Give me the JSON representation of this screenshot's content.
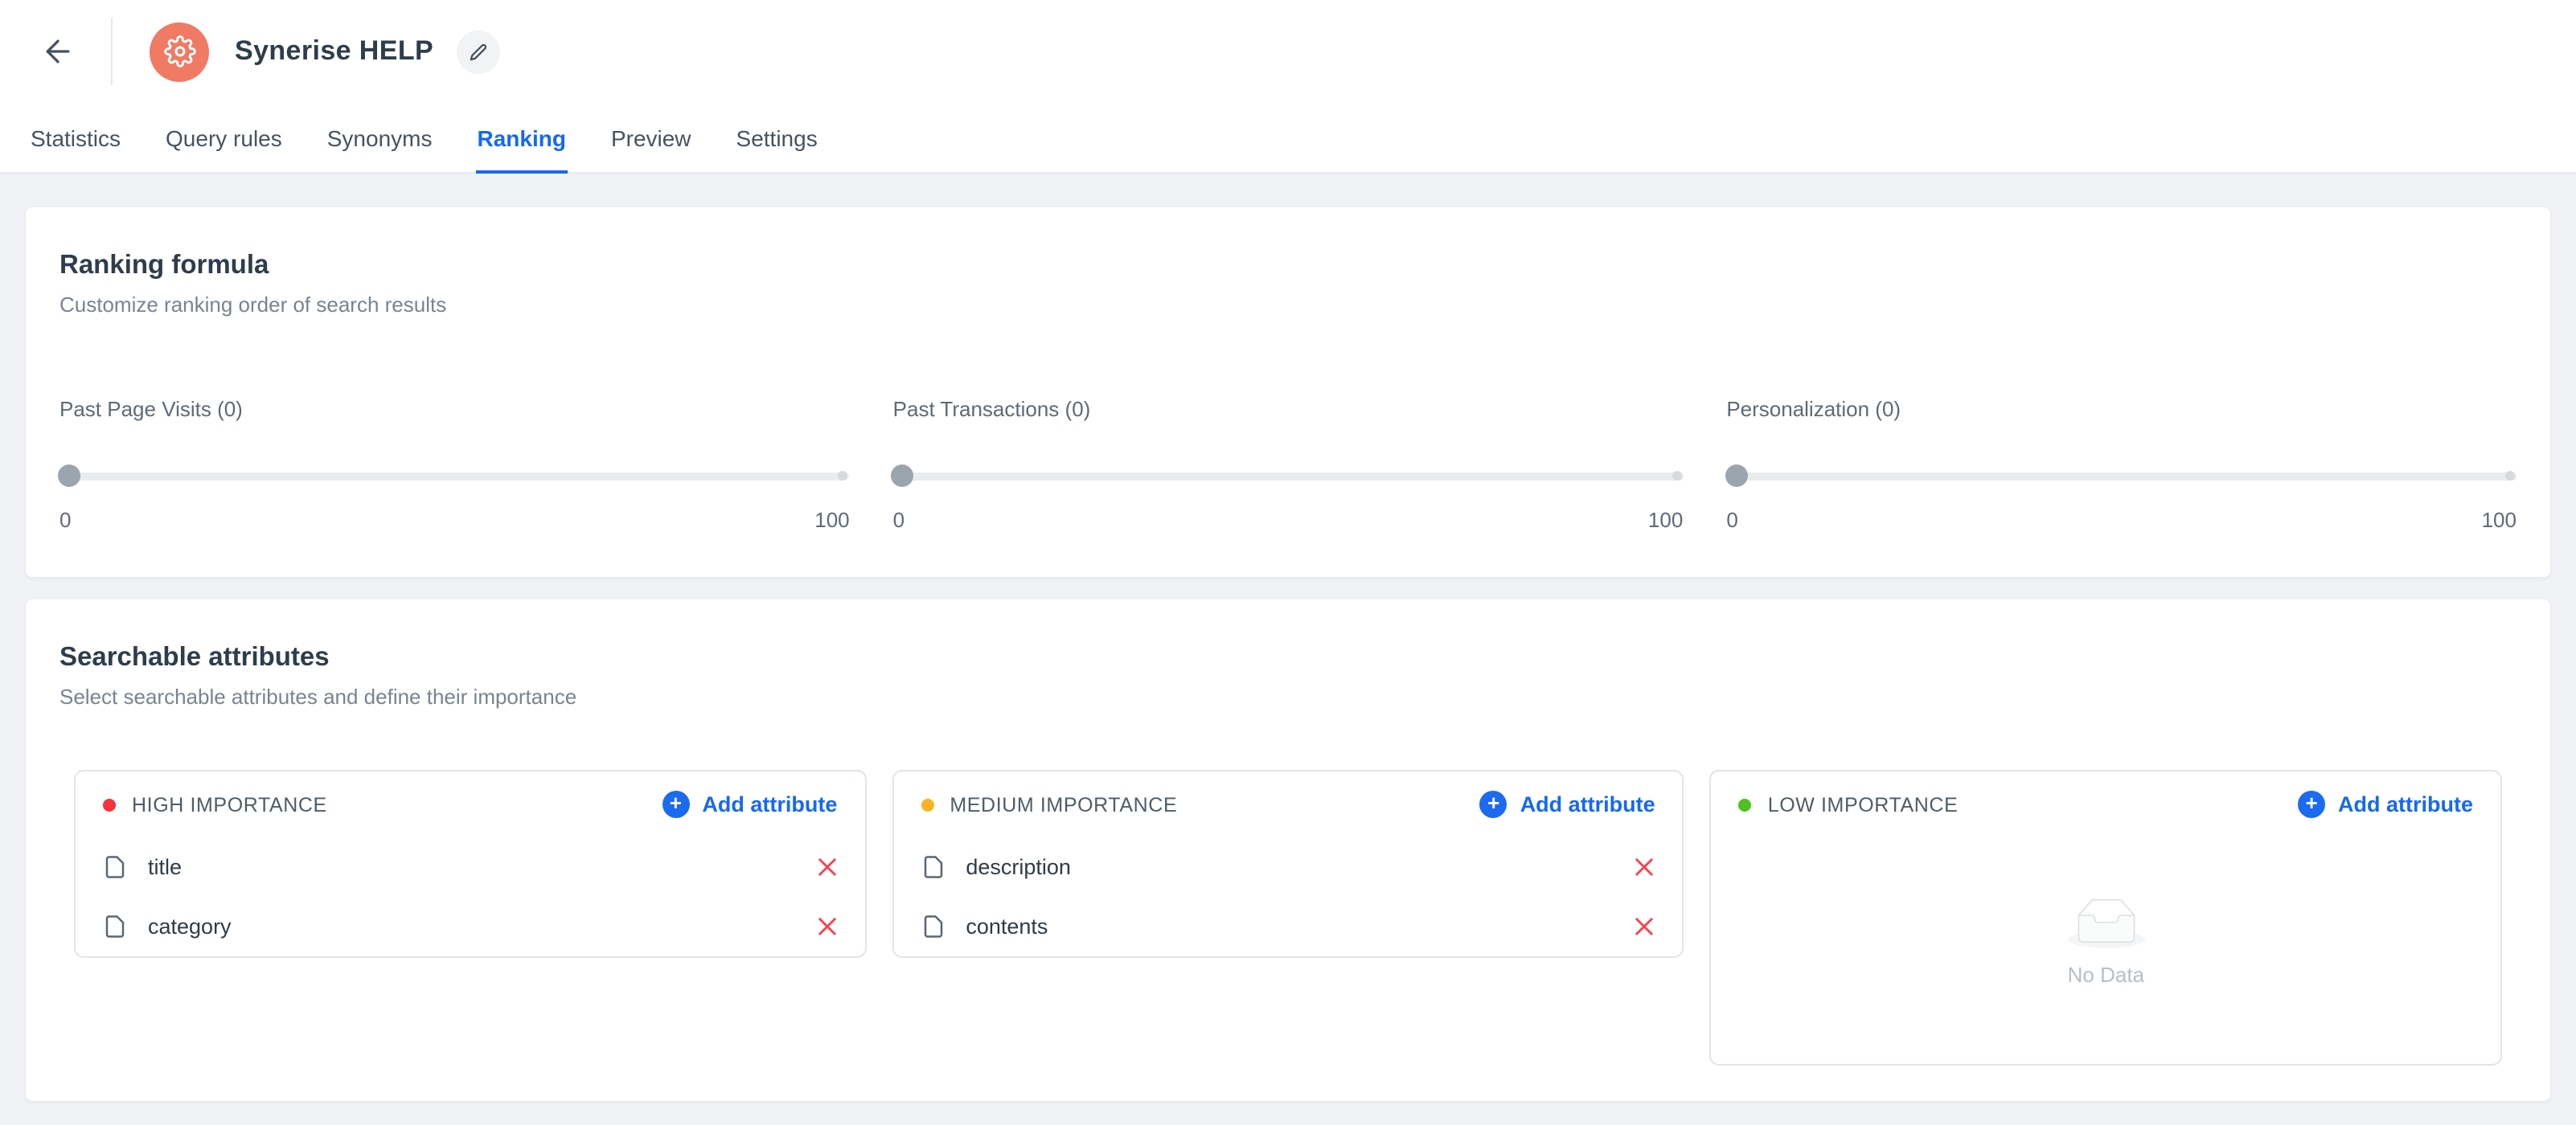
{
  "header": {
    "app_title": "Synerise HELP"
  },
  "tabs": {
    "items": [
      {
        "label": "Statistics",
        "active": false
      },
      {
        "label": "Query rules",
        "active": false
      },
      {
        "label": "Synonyms",
        "active": false
      },
      {
        "label": "Ranking",
        "active": true
      },
      {
        "label": "Preview",
        "active": false
      },
      {
        "label": "Settings",
        "active": false
      }
    ]
  },
  "ranking": {
    "title": "Ranking formula",
    "subtitle": "Customize ranking order of search results",
    "sliders": [
      {
        "label": "Past Page Visits (0)",
        "value": 0,
        "min_label": "0",
        "max_label": "100"
      },
      {
        "label": "Past Transactions (0)",
        "value": 0,
        "min_label": "0",
        "max_label": "100"
      },
      {
        "label": "Personalization (0)",
        "value": 0,
        "min_label": "0",
        "max_label": "100"
      }
    ]
  },
  "attributes": {
    "title": "Searchable attributes",
    "subtitle": "Select searchable attributes and define their importance",
    "groups": [
      {
        "name": "HIGH IMPORTANCE",
        "dot_color": "#f8323c",
        "add_label": "Add attribute",
        "items": [
          "title",
          "category"
        ]
      },
      {
        "name": "MEDIUM IMPORTANCE",
        "dot_color": "#fcb322",
        "add_label": "Add attribute",
        "items": [
          "description",
          "contents"
        ]
      },
      {
        "name": "LOW IMPORTANCE",
        "dot_color": "#4ec11e",
        "add_label": "Add attribute",
        "items": [],
        "empty_label": "No Data"
      }
    ]
  },
  "colors": {
    "accent_blue": "#1668f2",
    "logo_coral": "#f07a64",
    "remove_red": "#fc3d4a",
    "page_background": "#f0f2f5"
  }
}
